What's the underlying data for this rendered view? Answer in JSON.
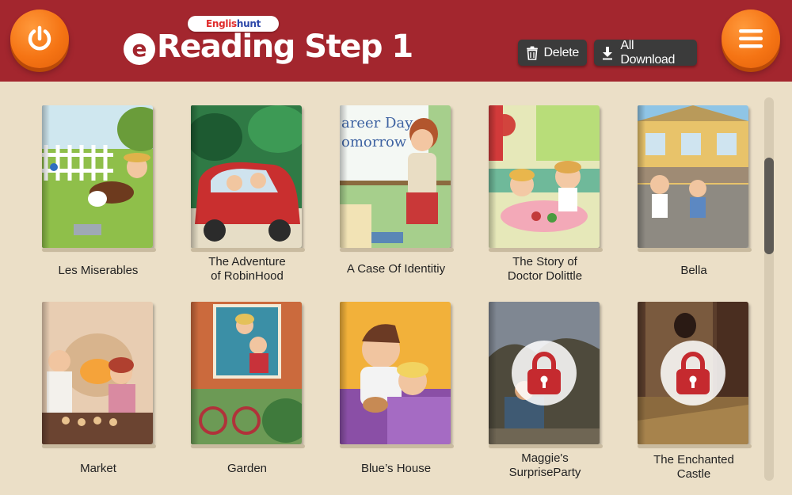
{
  "header": {
    "brand_part1": "Englis",
    "brand_part2": "hunt",
    "title": "Reading Step 1",
    "logo_letter": "e",
    "buttons": {
      "delete_label": "Delete",
      "download_label": "All Download"
    },
    "icons": {
      "power": "power-icon",
      "menu": "hamburger-menu-icon",
      "delete": "trash-icon",
      "download": "download-icon"
    },
    "colors": {
      "bar": "#a3262e",
      "accent": "#f57414"
    }
  },
  "books": [
    {
      "title_line1": "Les Miserables",
      "title_line2": "",
      "locked": false
    },
    {
      "title_line1": "The Adventure",
      "title_line2": "of RobinHood",
      "locked": false
    },
    {
      "title_line1": "A Case Of Identitiy",
      "title_line2": "",
      "locked": false
    },
    {
      "title_line1": "The Story of",
      "title_line2": "Doctor Dolittle",
      "locked": false
    },
    {
      "title_line1": "Bella",
      "title_line2": "",
      "locked": false
    },
    {
      "title_line1": "Market",
      "title_line2": "",
      "locked": false
    },
    {
      "title_line1": "Garden",
      "title_line2": "",
      "locked": false
    },
    {
      "title_line1": "Blue’s House",
      "title_line2": "",
      "locked": false
    },
    {
      "title_line1": "Maggie's",
      "title_line2": "SurpriseParty",
      "locked": true
    },
    {
      "title_line1": "The Enchanted",
      "title_line2": "Castle",
      "locked": true
    }
  ],
  "cover_texts": {
    "career_day": "areer Day",
    "tomorrow": "omorrow"
  }
}
